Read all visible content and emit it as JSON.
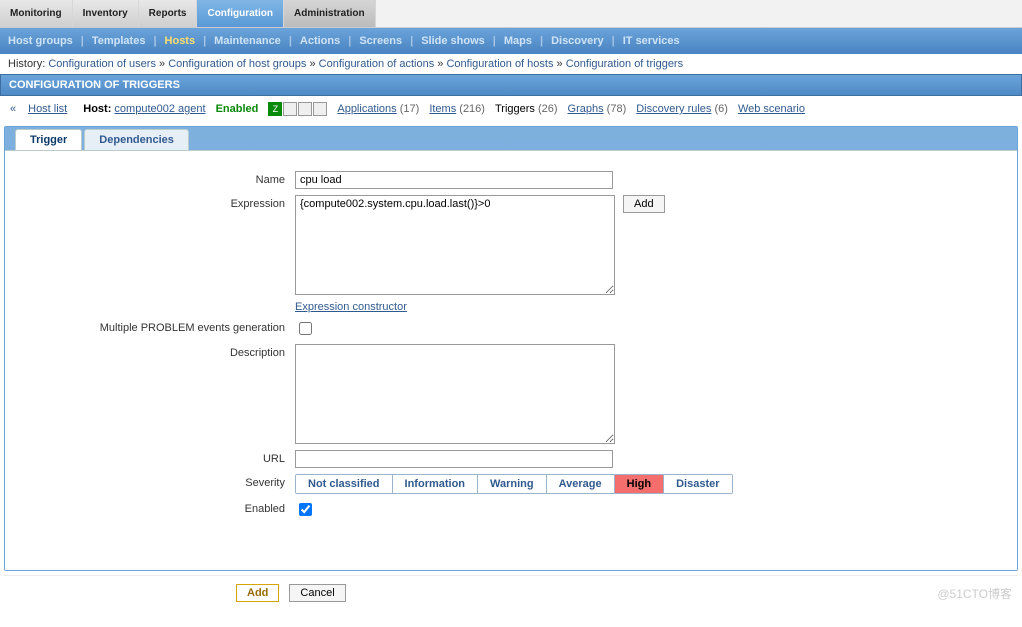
{
  "top_tabs": {
    "monitoring": "Monitoring",
    "inventory": "Inventory",
    "reports": "Reports",
    "configuration": "Configuration",
    "administration": "Administration"
  },
  "sub_nav": {
    "host_groups": "Host groups",
    "templates": "Templates",
    "hosts": "Hosts",
    "maintenance": "Maintenance",
    "actions": "Actions",
    "screens": "Screens",
    "slide_shows": "Slide shows",
    "maps": "Maps",
    "discovery": "Discovery",
    "it_services": "IT services"
  },
  "history": {
    "label": "History:",
    "items": [
      "Configuration of users",
      "Configuration of host groups",
      "Configuration of actions",
      "Configuration of hosts",
      "Configuration of triggers"
    ],
    "sep": " » "
  },
  "page_title": "CONFIGURATION OF TRIGGERS",
  "host_row": {
    "back": "Host list",
    "host_label": "Host:",
    "host_link": "compute002  agent",
    "enabled": "Enabled",
    "applications_label": "Applications",
    "applications_count": "(17)",
    "items_label": "Items",
    "items_count": "(216)",
    "triggers_label": "Triggers",
    "triggers_count": "(26)",
    "graphs_label": "Graphs",
    "graphs_count": "(78)",
    "discovery_label": "Discovery rules",
    "discovery_count": "(6)",
    "web_label": "Web scenario"
  },
  "avail": {
    "z": "Z"
  },
  "panel": {
    "tab_trigger": "Trigger",
    "tab_dependencies": "Dependencies"
  },
  "form": {
    "name_label": "Name",
    "name_value": "cpu load",
    "expr_label": "Expression",
    "expr_value": "{compute002.system.cpu.load.last()}>0",
    "expr_add": "Add",
    "expr_constructor": "Expression constructor",
    "multi_label": "Multiple PROBLEM events generation",
    "desc_label": "Description",
    "desc_value": "",
    "url_label": "URL",
    "url_value": "",
    "severity_label": "Severity",
    "sev": {
      "not_classified": "Not classified",
      "information": "Information",
      "warning": "Warning",
      "average": "Average",
      "high": "High",
      "disaster": "Disaster"
    },
    "enabled_label": "Enabled"
  },
  "actions": {
    "add": "Add",
    "cancel": "Cancel"
  },
  "watermark": "@51CTO博客"
}
